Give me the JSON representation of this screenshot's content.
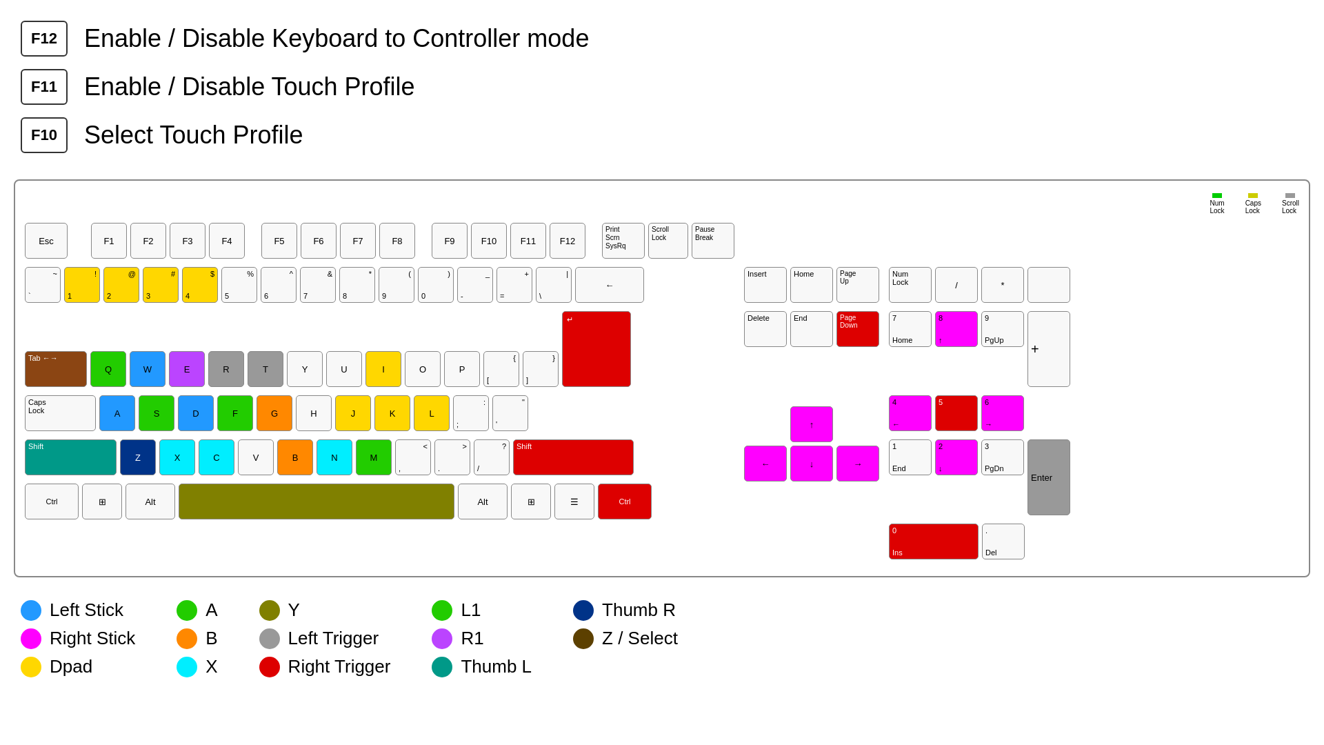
{
  "instructions": [
    {
      "key": "F12",
      "text": "Enable / Disable Keyboard to Controller mode"
    },
    {
      "key": "F11",
      "text": "Enable / Disable Touch Profile"
    },
    {
      "key": "F10",
      "text": "Select Touch Profile"
    }
  ],
  "legend": [
    {
      "items": [
        {
          "color": "#2299FF",
          "label": "Left Stick"
        },
        {
          "color": "#FF00FF",
          "label": "Right Stick"
        },
        {
          "color": "#FFD700",
          "label": "Dpad"
        }
      ]
    },
    {
      "items": [
        {
          "color": "#22CC00",
          "label": "A"
        },
        {
          "color": "#FF8800",
          "label": "B"
        },
        {
          "color": "#00EEFF",
          "label": "X"
        }
      ]
    },
    {
      "items": [
        {
          "color": "#808000",
          "label": "Y"
        },
        {
          "color": "#999999",
          "label": "Left Trigger"
        },
        {
          "color": "#DD0000",
          "label": "Right Trigger"
        }
      ]
    },
    {
      "items": [
        {
          "color": "#22CC00",
          "label": "L1"
        },
        {
          "color": "#BB44FF",
          "label": "R1"
        },
        {
          "color": "#009988",
          "label": "Thumb L"
        }
      ]
    },
    {
      "items": [
        {
          "color": "#003388",
          "label": "Thumb R"
        },
        {
          "color": "#5C4000",
          "label": "Z / Select"
        }
      ]
    }
  ]
}
